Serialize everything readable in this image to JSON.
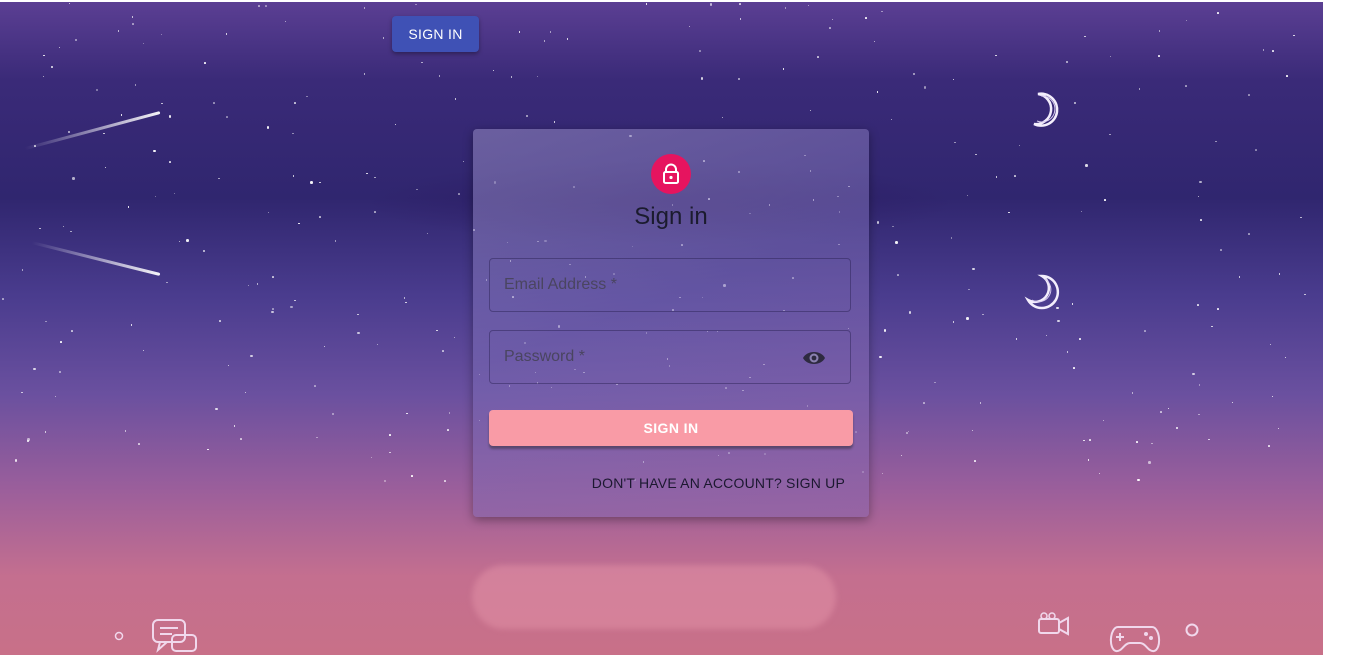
{
  "header": {
    "signin_button_label": "SIGN IN"
  },
  "form": {
    "title": "Sign in",
    "email": {
      "placeholder": "Email Address *",
      "value": ""
    },
    "password": {
      "placeholder": "Password *",
      "value": ""
    },
    "submit_label": "SIGN IN",
    "signup_link": "DON'T HAVE AN ACCOUNT? SIGN UP"
  },
  "icons": {
    "avatar": "lock-icon",
    "password_toggle": "eye-icon",
    "decor": [
      "chat-bubble-icon",
      "video-camera-icon",
      "gamepad-icon",
      "moon-icon"
    ]
  },
  "colors": {
    "top_button": "#3f51b5",
    "avatar": "#e6145f",
    "submit_button": "#f99ba6"
  }
}
